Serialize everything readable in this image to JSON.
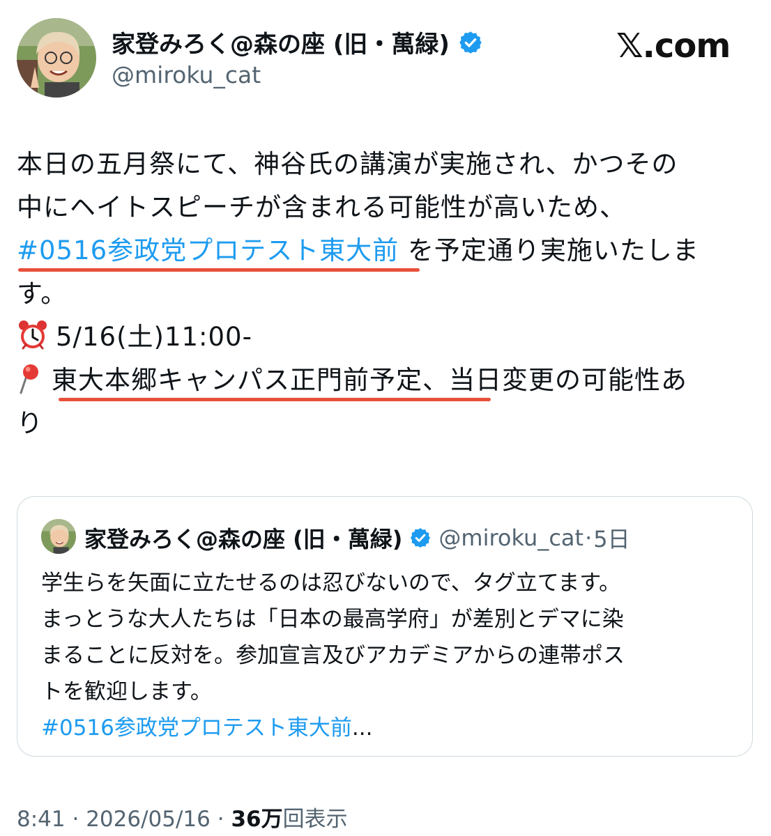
{
  "author": {
    "display_name": "家登みろく@森の座 (旧・萬緑)",
    "handle": "@miroku_cat",
    "verified_icon": "verified-badge-icon"
  },
  "brand": "𝕏.com",
  "post": {
    "lines": [
      "本日の五月祭にて、神谷氏の講演が実施され、かつその",
      "中にヘイトスピーチが含まれる可能性が高いため、",
      "を予定通り実施いたしま",
      "す。",
      "5/16(土)11:00-",
      "東大本郷キャンパス正門前予定、",
      "当日変更の可能性あ",
      "り"
    ],
    "hashtag": "#0516参政党プロテスト東大前",
    "alarm_icon": "alarm-clock-icon",
    "pin_icon": "round-pushpin-icon",
    "annotation_color": "#e8503a"
  },
  "quoted": {
    "display_name": "家登みろく@森の座 (旧・萬緑)",
    "handle": "@miroku_cat",
    "separator": "·",
    "age": "5日",
    "lines": [
      "学生らを矢面に立たせるのは忍びないので、タグ立てます。",
      "まっとうな大人たちは「日本の最高学府」が差別とデマに染",
      "まることに反対を。参加宣言及びアカデミアからの連帯ポス",
      "トを歓迎します。"
    ],
    "hashtag": "#0516参政党プロテスト東大前",
    "ellipsis": "..."
  },
  "meta": {
    "time": "8:41",
    "sep1": " · ",
    "date": "2026/05/16",
    "sep2": " · ",
    "views": "36万",
    "views_label": "回表示"
  },
  "colors": {
    "link": "#1d9bf0",
    "verified": "#1d9bf0",
    "secondary_text": "#536471"
  }
}
